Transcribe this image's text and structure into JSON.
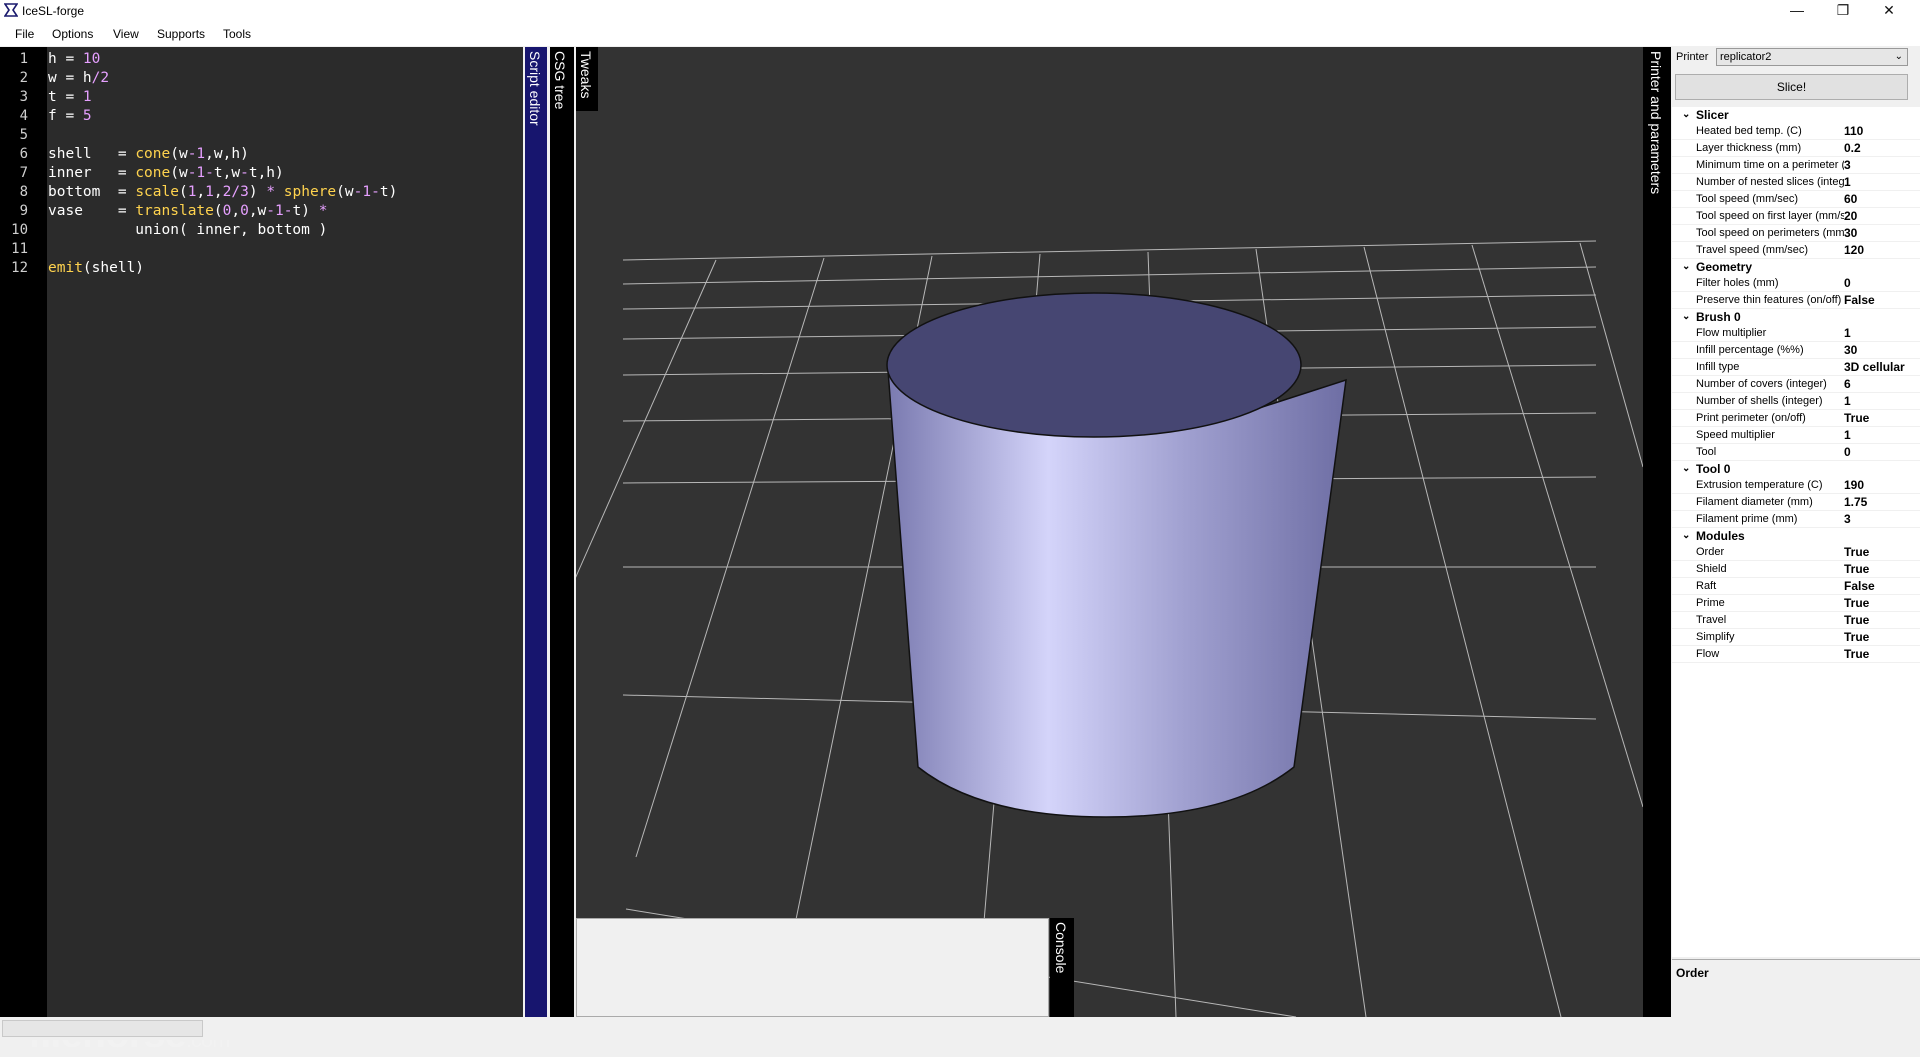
{
  "window": {
    "title": "IceSL-forge",
    "minimize_icon": "—",
    "maximize_icon": "❐",
    "close_icon": "✕"
  },
  "menu": [
    "File",
    "Options",
    "View",
    "Supports",
    "Tools"
  ],
  "editor": {
    "lines": [
      {
        "n": "1",
        "parts": [
          {
            "t": "h = ",
            "c": ""
          },
          {
            "t": "10",
            "c": "n"
          }
        ]
      },
      {
        "n": "2",
        "parts": [
          {
            "t": "w = h",
            "c": ""
          },
          {
            "t": "/",
            "c": "o"
          },
          {
            "t": "2",
            "c": "n"
          }
        ]
      },
      {
        "n": "3",
        "parts": [
          {
            "t": "t = ",
            "c": ""
          },
          {
            "t": "1",
            "c": "n"
          }
        ]
      },
      {
        "n": "4",
        "parts": [
          {
            "t": "f = ",
            "c": ""
          },
          {
            "t": "5",
            "c": "n"
          }
        ]
      },
      {
        "n": "5",
        "parts": []
      },
      {
        "n": "6",
        "parts": [
          {
            "t": "shell   = ",
            "c": ""
          },
          {
            "t": "cone",
            "c": "k"
          },
          {
            "t": "(w",
            "c": ""
          },
          {
            "t": "-1",
            "c": "n"
          },
          {
            "t": ",w,h)",
            "c": ""
          }
        ]
      },
      {
        "n": "7",
        "parts": [
          {
            "t": "inner   = ",
            "c": ""
          },
          {
            "t": "cone",
            "c": "k"
          },
          {
            "t": "(w",
            "c": ""
          },
          {
            "t": "-1-",
            "c": "n"
          },
          {
            "t": "t,w",
            "c": ""
          },
          {
            "t": "-",
            "c": "o"
          },
          {
            "t": "t,h)",
            "c": ""
          }
        ]
      },
      {
        "n": "8",
        "parts": [
          {
            "t": "bottom  = ",
            "c": ""
          },
          {
            "t": "scale",
            "c": "k"
          },
          {
            "t": "(",
            "c": ""
          },
          {
            "t": "1",
            "c": "n"
          },
          {
            "t": ",",
            "c": ""
          },
          {
            "t": "1",
            "c": "n"
          },
          {
            "t": ",",
            "c": ""
          },
          {
            "t": "2/3",
            "c": "n"
          },
          {
            "t": ") ",
            "c": ""
          },
          {
            "t": "*",
            "c": "o"
          },
          {
            "t": " ",
            "c": ""
          },
          {
            "t": "sphere",
            "c": "k"
          },
          {
            "t": "(w",
            "c": ""
          },
          {
            "t": "-1-",
            "c": "n"
          },
          {
            "t": "t)",
            "c": ""
          }
        ]
      },
      {
        "n": "9",
        "parts": [
          {
            "t": "vase    = ",
            "c": ""
          },
          {
            "t": "translate",
            "c": "k"
          },
          {
            "t": "(",
            "c": ""
          },
          {
            "t": "0",
            "c": "n"
          },
          {
            "t": ",",
            "c": ""
          },
          {
            "t": "0",
            "c": "n"
          },
          {
            "t": ",w",
            "c": ""
          },
          {
            "t": "-1-",
            "c": "n"
          },
          {
            "t": "t) ",
            "c": ""
          },
          {
            "t": "*",
            "c": "o"
          }
        ]
      },
      {
        "n": "10",
        "parts": [
          {
            "t": "          union( inner, bottom )",
            "c": ""
          }
        ]
      },
      {
        "n": "11",
        "parts": []
      },
      {
        "n": "12",
        "parts": [
          {
            "t": "emit",
            "c": "k"
          },
          {
            "t": "(shell)",
            "c": ""
          }
        ]
      }
    ]
  },
  "tabs": {
    "script_editor": "Script editor",
    "csg_tree": "CSG tree",
    "tweaks": "Tweaks",
    "console": "Console",
    "printer_and_parameters": "Printer and parameters"
  },
  "printer": {
    "label": "Printer",
    "selected": "replicator2",
    "slice_button": "Slice!"
  },
  "params": [
    {
      "section": "Slicer",
      "rows": [
        {
          "name": "Heated bed temp. (C)",
          "value": "110"
        },
        {
          "name": "Layer thickness (mm)",
          "value": "0.2"
        },
        {
          "name": "Minimum time on a perimeter (s",
          "value": "3"
        },
        {
          "name": "Number of nested slices (intege",
          "value": "1"
        },
        {
          "name": "Tool speed (mm/sec)",
          "value": "60"
        },
        {
          "name": "Tool speed on first layer (mm/s",
          "value": "20"
        },
        {
          "name": "Tool speed on perimeters (mm.",
          "value": "30"
        },
        {
          "name": "Travel speed (mm/sec)",
          "value": "120"
        }
      ]
    },
    {
      "section": "Geometry",
      "rows": [
        {
          "name": "Filter holes (mm)",
          "value": "0"
        },
        {
          "name": "Preserve thin features (on/off)",
          "value": "False"
        }
      ]
    },
    {
      "section": "Brush 0",
      "rows": [
        {
          "name": "Flow multiplier",
          "value": "1"
        },
        {
          "name": "Infill percentage (%%)",
          "value": "30"
        },
        {
          "name": "Infill type",
          "value": "3D cellular"
        },
        {
          "name": "Number of covers (integer)",
          "value": "6"
        },
        {
          "name": "Number of shells (integer)",
          "value": "1"
        },
        {
          "name": "Print perimeter (on/off)",
          "value": "True"
        },
        {
          "name": "Speed multiplier",
          "value": "1"
        },
        {
          "name": "Tool",
          "value": "0"
        }
      ]
    },
    {
      "section": "Tool 0",
      "rows": [
        {
          "name": "Extrusion temperature (C)",
          "value": "190"
        },
        {
          "name": "Filament diameter (mm)",
          "value": "1.75"
        },
        {
          "name": "Filament prime (mm)",
          "value": "3"
        }
      ]
    },
    {
      "section": "Modules",
      "rows": [
        {
          "name": "Order",
          "value": "True"
        },
        {
          "name": "Shield",
          "value": "True"
        },
        {
          "name": "Raft",
          "value": "False"
        },
        {
          "name": "Prime",
          "value": "True"
        },
        {
          "name": "Travel",
          "value": "True"
        },
        {
          "name": "Simplify",
          "value": "True"
        },
        {
          "name": "Flow",
          "value": "True"
        }
      ]
    }
  ],
  "description": {
    "title": "Order"
  },
  "watermark": {
    "main": "filehorse",
    "suffix": ".com"
  },
  "colors": {
    "viewport_bg": "#333333",
    "object_fill": "#a8a8d8",
    "script_tab": "#17156e"
  }
}
